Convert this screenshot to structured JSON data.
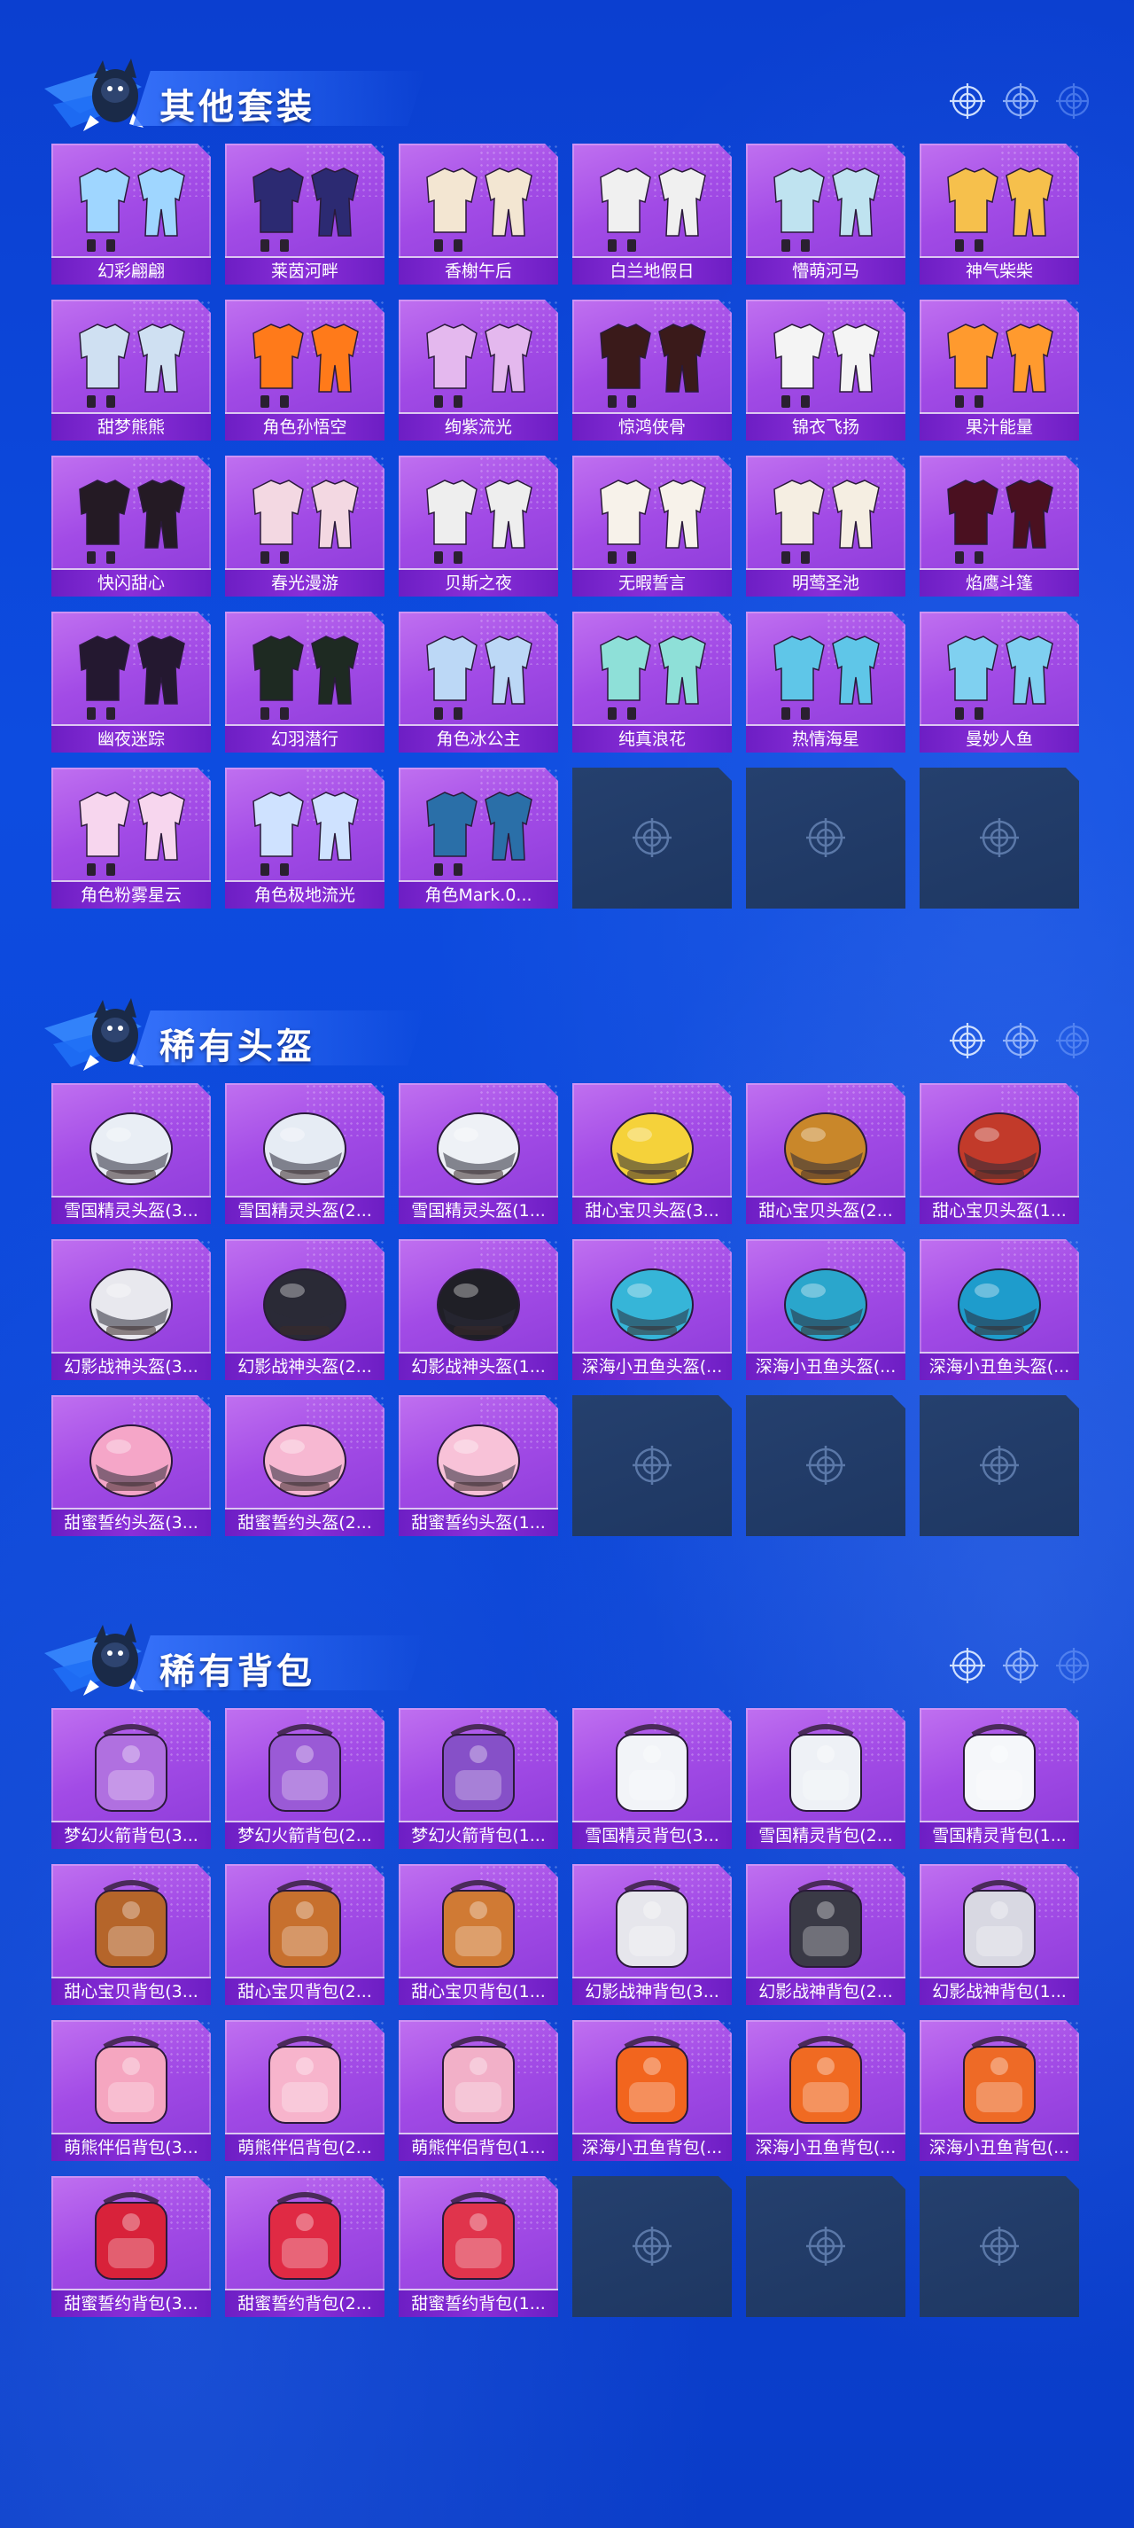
{
  "sections": [
    {
      "title": "其他套装",
      "items": [
        {
          "label": "幻彩翩翩",
          "icon": "outfit-pastel-icon",
          "color": "#9fd6ff"
        },
        {
          "label": "莱茵河畔",
          "icon": "outfit-navy-plaid-icon",
          "color": "#2c2a72"
        },
        {
          "label": "香榭午后",
          "icon": "outfit-cream-icon",
          "color": "#f3e6d2"
        },
        {
          "label": "白兰地假日",
          "icon": "outfit-black-white-icon",
          "color": "#f0f0f0"
        },
        {
          "label": "懵萌河马",
          "icon": "outfit-hippo-icon",
          "color": "#bfe3f0"
        },
        {
          "label": "神气柴柴",
          "icon": "outfit-shiba-icon",
          "color": "#f6c04c"
        },
        {
          "label": "甜梦熊熊",
          "icon": "outfit-bear-pajama-icon",
          "color": "#cfe0f2"
        },
        {
          "label": "角色孙悟空",
          "icon": "character-goku-icon",
          "color": "#ff7a1a"
        },
        {
          "label": "绚紫流光",
          "icon": "outfit-lilac-icon",
          "color": "#e4b8ee"
        },
        {
          "label": "惊鸿侠骨",
          "icon": "outfit-dark-robe-icon",
          "color": "#3a1a1a"
        },
        {
          "label": "锦衣飞扬",
          "icon": "outfit-white-robe-icon",
          "color": "#f4f4f4"
        },
        {
          "label": "果汁能量",
          "icon": "outfit-orange-jacket-icon",
          "color": "#ff9a2e"
        },
        {
          "label": "快闪甜心",
          "icon": "outfit-black-pink-icon",
          "color": "#241a24"
        },
        {
          "label": "春光漫游",
          "icon": "outfit-pink-coat-icon",
          "color": "#f3d8e2"
        },
        {
          "label": "贝斯之夜",
          "icon": "outfit-white-red-icon",
          "color": "#eeeeee"
        },
        {
          "label": "无暇誓言",
          "icon": "outfit-white-dress-icon",
          "color": "#f7f2ea"
        },
        {
          "label": "明莺圣池",
          "icon": "outfit-white-gold-icon",
          "color": "#f5eee2"
        },
        {
          "label": "焰鹰斗篷",
          "icon": "outfit-red-cloak-icon",
          "color": "#4a1020"
        },
        {
          "label": "幽夜迷踪",
          "icon": "outfit-neon-black-icon",
          "color": "#241830"
        },
        {
          "label": "幻羽潜行",
          "icon": "outfit-green-black-icon",
          "color": "#1e2a22"
        },
        {
          "label": "角色冰公主",
          "icon": "character-ice-princess-icon",
          "color": "#bcd8f6"
        },
        {
          "label": "纯真浪花",
          "icon": "outfit-aqua-yellow-icon",
          "color": "#8ee0d8"
        },
        {
          "label": "热情海星",
          "icon": "outfit-aqua-pink-icon",
          "color": "#5fc6e8"
        },
        {
          "label": "曼妙人鱼",
          "icon": "outfit-mermaid-icon",
          "color": "#7fd0f0"
        },
        {
          "label": "角色粉雾星云",
          "icon": "character-pink-nebula-icon",
          "color": "#f7d6ee"
        },
        {
          "label": "角色极地流光",
          "icon": "character-polar-icon",
          "color": "#cfe2ff"
        },
        {
          "label": "角色Mark.0...",
          "icon": "character-mark-suit-icon",
          "color": "#2a6fa8"
        }
      ]
    },
    {
      "title": "稀有头盔",
      "items": [
        {
          "label": "雪国精灵头盔(3...",
          "icon": "helmet-snow-spirit-lv3-icon",
          "color": "#e9eef5"
        },
        {
          "label": "雪国精灵头盔(2...",
          "icon": "helmet-snow-spirit-lv2-icon",
          "color": "#e6ecf4"
        },
        {
          "label": "雪国精灵头盔(1...",
          "icon": "helmet-snow-spirit-lv1-icon",
          "color": "#eef1f6"
        },
        {
          "label": "甜心宝贝头盔(3...",
          "icon": "helmet-sweetheart-lv3-icon",
          "color": "#f5d23a"
        },
        {
          "label": "甜心宝贝头盔(2...",
          "icon": "helmet-sweetheart-lv2-icon",
          "color": "#c9872a"
        },
        {
          "label": "甜心宝贝头盔(1...",
          "icon": "helmet-sweetheart-lv1-icon",
          "color": "#c23a2a"
        },
        {
          "label": "幻影战神头盔(3...",
          "icon": "helmet-phantom-lv3-icon",
          "color": "#e8e8ee"
        },
        {
          "label": "幻影战神头盔(2...",
          "icon": "helmet-phantom-lv2-icon",
          "color": "#2a2a36"
        },
        {
          "label": "幻影战神头盔(1...",
          "icon": "helmet-phantom-lv1-icon",
          "color": "#1f1f26"
        },
        {
          "label": "深海小丑鱼头盔(...",
          "icon": "helmet-clownfish-lv3-icon",
          "color": "#36b5d8"
        },
        {
          "label": "深海小丑鱼头盔(...",
          "icon": "helmet-clownfish-lv2-icon",
          "color": "#2aa6cc"
        },
        {
          "label": "深海小丑鱼头盔(...",
          "icon": "helmet-clownfish-lv1-icon",
          "color": "#1e9ccc"
        },
        {
          "label": "甜蜜誓约头盔(3...",
          "icon": "helmet-sweet-vow-lv3-icon",
          "color": "#f5a6c8"
        },
        {
          "label": "甜蜜誓约头盔(2...",
          "icon": "helmet-sweet-vow-lv2-icon",
          "color": "#f7b8d2"
        },
        {
          "label": "甜蜜誓约头盔(1...",
          "icon": "helmet-sweet-vow-lv1-icon",
          "color": "#f8c2d8"
        }
      ]
    },
    {
      "title": "稀有背包",
      "items": [
        {
          "label": "梦幻火箭背包(3...",
          "icon": "backpack-dream-rocket-lv3-icon",
          "color": "#b070e0"
        },
        {
          "label": "梦幻火箭背包(2...",
          "icon": "backpack-dream-rocket-lv2-icon",
          "color": "#9a5ad6"
        },
        {
          "label": "梦幻火箭背包(1...",
          "icon": "backpack-dream-rocket-lv1-icon",
          "color": "#8650c8"
        },
        {
          "label": "雪国精灵背包(3...",
          "icon": "backpack-snowman-lv3-icon",
          "color": "#f2f4f8"
        },
        {
          "label": "雪国精灵背包(2...",
          "icon": "backpack-snowman-lv2-icon",
          "color": "#eef1f6"
        },
        {
          "label": "雪国精灵背包(1...",
          "icon": "backpack-snowman-lv1-icon",
          "color": "#f5f7fa"
        },
        {
          "label": "甜心宝贝背包(3...",
          "icon": "backpack-sweetheart-lv3-icon",
          "color": "#b5652a"
        },
        {
          "label": "甜心宝贝背包(2...",
          "icon": "backpack-sweetheart-lv2-icon",
          "color": "#c7702e"
        },
        {
          "label": "甜心宝贝背包(1...",
          "icon": "backpack-sweetheart-lv1-icon",
          "color": "#d07a34"
        },
        {
          "label": "幻影战神背包(3...",
          "icon": "backpack-phantom-lv3-icon",
          "color": "#e6e6ec"
        },
        {
          "label": "幻影战神背包(2...",
          "icon": "backpack-phantom-lv2-icon",
          "color": "#3a3a46"
        },
        {
          "label": "幻影战神背包(1...",
          "icon": "backpack-phantom-lv1-icon",
          "color": "#d8d8e2"
        },
        {
          "label": "萌熊伴侣背包(3...",
          "icon": "backpack-bear-lv3-icon",
          "color": "#f5a6c0"
        },
        {
          "label": "萌熊伴侣背包(2...",
          "icon": "backpack-bear-lv2-icon",
          "color": "#f7b4cc"
        },
        {
          "label": "萌熊伴侣背包(1...",
          "icon": "backpack-bear-lv1-icon",
          "color": "#f2b0c8"
        },
        {
          "label": "深海小丑鱼背包(...",
          "icon": "backpack-clownfish-lv3-icon",
          "color": "#f2651e"
        },
        {
          "label": "深海小丑鱼背包(...",
          "icon": "backpack-clownfish-lv2-icon",
          "color": "#f06a22"
        },
        {
          "label": "深海小丑鱼背包(...",
          "icon": "backpack-clownfish-lv1-icon",
          "color": "#ee6a26"
        },
        {
          "label": "甜蜜誓约背包(3...",
          "icon": "backpack-sweet-vow-lv3-icon",
          "color": "#d8223a"
        },
        {
          "label": "甜蜜誓约背包(2...",
          "icon": "backpack-sweet-vow-lv2-icon",
          "color": "#e02a44"
        },
        {
          "label": "甜蜜誓约背包(1...",
          "icon": "backpack-sweet-vow-lv1-icon",
          "color": "#e0344c"
        }
      ]
    }
  ],
  "icons": {
    "mascot": "mascot-creature-icon",
    "section_dots": "crosshair-dots-icon",
    "empty_slot": "crosshair-icon"
  },
  "colors": {
    "background": "#0c46d8",
    "card_purple": "#a24be6",
    "label_purple": "#7a26cc",
    "empty_slot": "#22406c"
  }
}
